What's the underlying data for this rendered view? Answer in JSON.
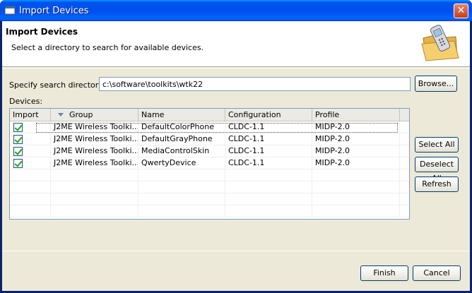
{
  "window": {
    "title": "Import Devices",
    "close_glyph": "✕"
  },
  "banner": {
    "title": "Import Devices",
    "description": "Select a directory to search for available devices.",
    "icon": "phone-folder-icon"
  },
  "search": {
    "label": "Specify search directory:",
    "value": "c:\\software\\toolkits\\wtk22",
    "browse_label": "Browse..."
  },
  "devices": {
    "label": "Devices:",
    "columns": [
      "Import",
      "Group",
      "Name",
      "Configuration",
      "Profile"
    ],
    "rows": [
      {
        "checked": true,
        "group": "J2ME Wireless Toolki...",
        "name": "DefaultColorPhone",
        "configuration": "CLDC-1.1",
        "profile": "MIDP-2.0"
      },
      {
        "checked": true,
        "group": "J2ME Wireless Toolki...",
        "name": "DefaultGrayPhone",
        "configuration": "CLDC-1.1",
        "profile": "MIDP-2.0"
      },
      {
        "checked": true,
        "group": "J2ME Wireless Toolki...",
        "name": "MediaControlSkin",
        "configuration": "CLDC-1.1",
        "profile": "MIDP-2.0"
      },
      {
        "checked": true,
        "group": "J2ME Wireless Toolki...",
        "name": "QwertyDevice",
        "configuration": "CLDC-1.1",
        "profile": "MIDP-2.0"
      }
    ]
  },
  "side_buttons": {
    "select_all": "Select All",
    "deselect_all": "Deselect All",
    "refresh": "Refresh"
  },
  "footer": {
    "finish": "Finish",
    "cancel": "Cancel"
  }
}
